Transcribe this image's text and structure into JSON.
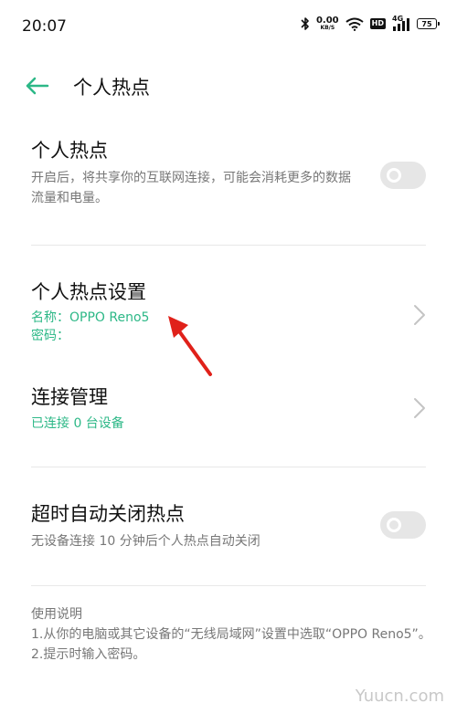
{
  "status": {
    "time": "20:07",
    "speed_value": "0.00",
    "speed_unit": "KB/S",
    "hd": "HD",
    "network": "4G",
    "battery": "75"
  },
  "header": {
    "title": "个人热点"
  },
  "hotspot": {
    "title": "个人热点",
    "description": "开启后，将共享你的互联网连接，可能会消耗更多的数据流量和电量。"
  },
  "settings": {
    "title": "个人热点设置",
    "name_line": "名称：OPPO Reno5",
    "password_line": "密码："
  },
  "connections": {
    "title": "连接管理",
    "status": "已连接 0 台设备"
  },
  "timeout": {
    "title": "超时自动关闭热点",
    "description": "无设备连接 10 分钟后个人热点自动关闭"
  },
  "usage": {
    "heading": "使用说明",
    "line1": "1.从你的电脑或其它设备的“无线局域网”设置中选取“OPPO Reno5”。",
    "line2": "2.提示时输入密码。"
  },
  "watermark": "Yuucn.com",
  "colors": {
    "accent": "#2db887",
    "annotation_arrow": "#e0211a",
    "toggle_off": "#e6e6e6"
  }
}
